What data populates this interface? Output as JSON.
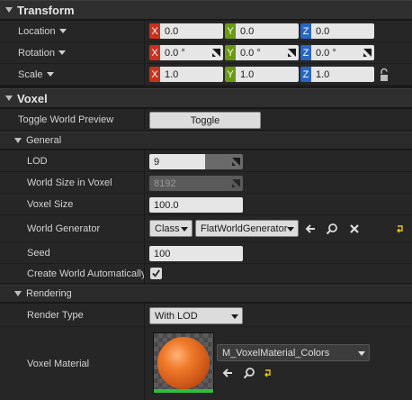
{
  "transform": {
    "title": "Transform",
    "location": {
      "label": "Location",
      "x": "0.0",
      "y": "0.0",
      "z": "0.0"
    },
    "rotation": {
      "label": "Rotation",
      "x": "0.0 °",
      "y": "0.0 °",
      "z": "0.0 °"
    },
    "scale": {
      "label": "Scale",
      "x": "1.0",
      "y": "1.0",
      "z": "1.0"
    },
    "axis_labels": {
      "x": "X",
      "y": "Y",
      "z": "Z"
    }
  },
  "voxel": {
    "title": "Voxel",
    "toggle_world_preview": {
      "label": "Toggle World Preview",
      "button": "Toggle"
    },
    "general": {
      "title": "General",
      "lod": {
        "label": "LOD",
        "value": "9",
        "fraction": 0.6
      },
      "world_size": {
        "label": "World Size in Voxel",
        "value": "8192"
      },
      "voxel_size": {
        "label": "Voxel Size",
        "value": "100.0"
      },
      "world_generator": {
        "label": "World Generator",
        "class_label": "Class",
        "value": "FlatWorldGenerator"
      },
      "seed": {
        "label": "Seed",
        "value": "100"
      },
      "create_world": {
        "label": "Create World Automatically",
        "checked": true
      }
    },
    "rendering": {
      "title": "Rendering",
      "render_type": {
        "label": "Render Type",
        "value": "With LOD"
      },
      "voxel_material": {
        "label": "Voxel Material",
        "value": "M_VoxelMaterial_Colors"
      }
    }
  }
}
